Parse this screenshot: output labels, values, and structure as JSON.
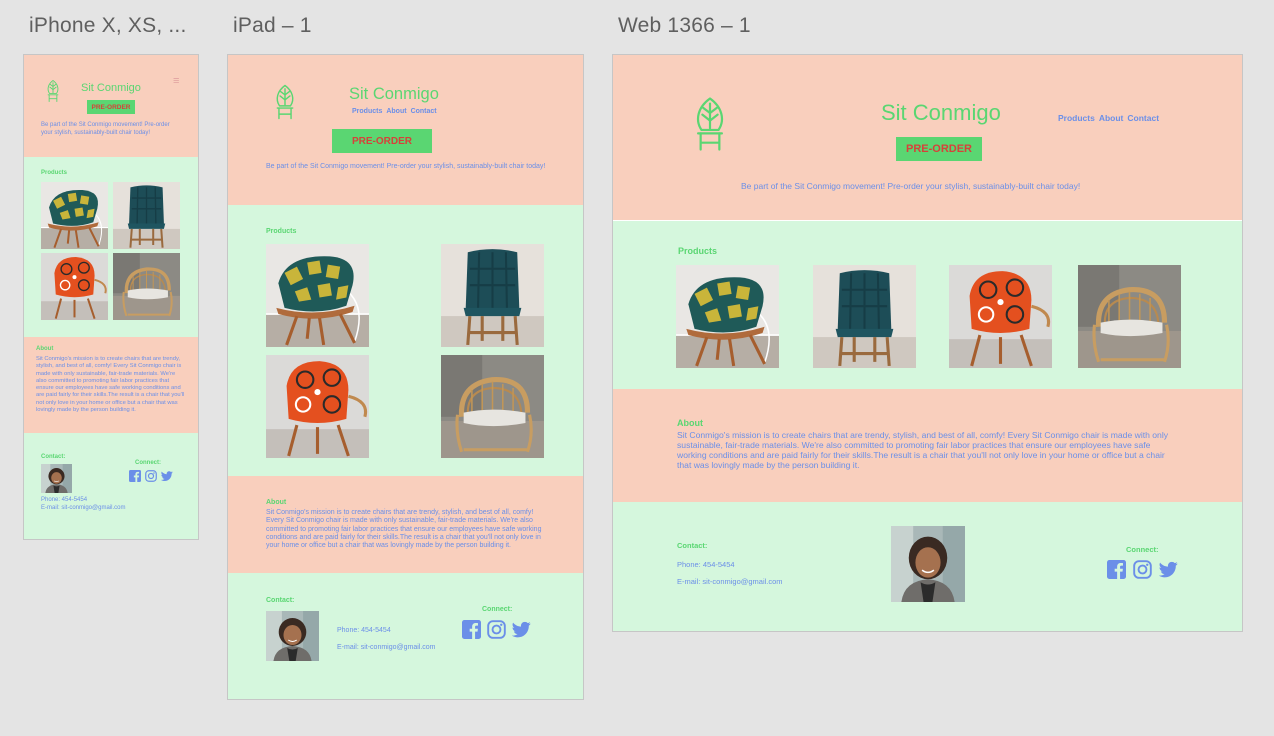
{
  "artboards": {
    "phone": {
      "label": "iPhone X, XS, ..."
    },
    "tablet": {
      "label": "iPad – 1"
    },
    "web": {
      "label": "Web 1366 – 1"
    }
  },
  "site": {
    "brand": "Sit Conmigo",
    "nav": {
      "products": "Products",
      "about": "About",
      "contact": "Contact"
    },
    "preorder": "PRE-ORDER",
    "tagline": "Be part of the Sit Conmigo movement! Pre-order your stylish, sustainably-built chair today!",
    "products_heading": "Products",
    "about_heading": "About",
    "about_text": "Sit Conmigo's mission is to create chairs that are trendy, stylish, and best of all, comfy! Every Sit Conmigo chair is made with only sustainable, fair-trade materials. We're also committed to promoting fair labor practices that ensure our employees have safe working conditions and are paid fairly for their skills.The result is a chair that you'll not only love in your home or office but a chair that was lovingly made by the person building it.",
    "contact_heading": "Contact:",
    "connect_heading": "Connect:",
    "phone": "Phone: 454-5454",
    "email": "E-mail: sit-conmigo@gmail.com"
  },
  "icons": {
    "menu": "≡",
    "logo": "leaf-chair-icon",
    "facebook": "facebook-icon",
    "instagram": "instagram-icon",
    "twitter": "twitter-icon"
  },
  "colors": {
    "peach": "#f9cfbd",
    "mint": "#d5f7dd",
    "brand_green": "#5ad672",
    "link_blue": "#6b8fe8",
    "cta_red": "#d6423a",
    "canvas": "#e4e4e4"
  }
}
